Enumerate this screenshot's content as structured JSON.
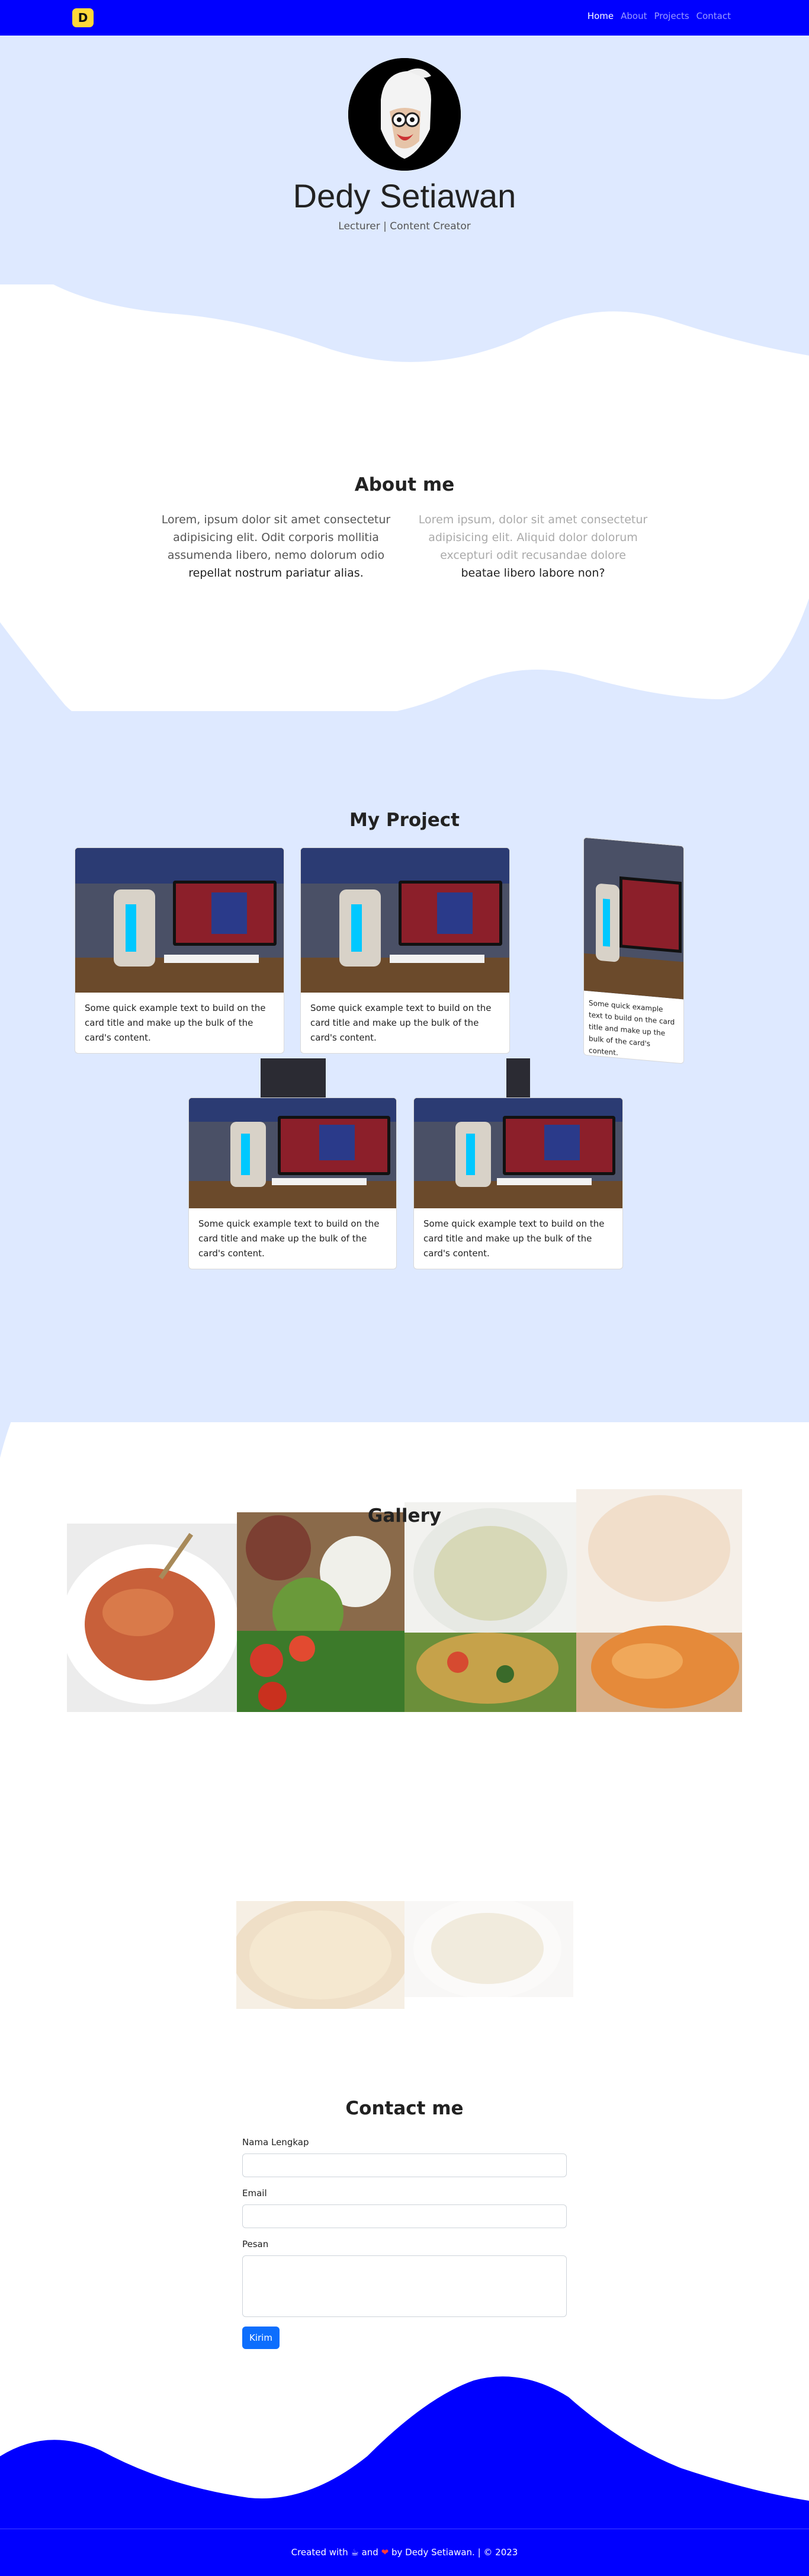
{
  "navbar": {
    "brand_letter": "D",
    "links": [
      {
        "label": "Home",
        "active": true
      },
      {
        "label": "About",
        "active": false
      },
      {
        "label": "Projects",
        "active": false
      },
      {
        "label": "Contact",
        "active": false
      }
    ]
  },
  "hero": {
    "name": "Dedy Setiawan",
    "subtitle": "Lecturer | Content Creator"
  },
  "about": {
    "title": "About me",
    "left_text": "Lorem, ipsum dolor sit amet consectetur adipisicing elit. Odit corporis mollitia assumenda libero, nemo dolorum odio",
    "left_strong": "repellat nostrum pariatur alias.",
    "right_text": "Lorem ipsum, dolor sit amet consectetur adipisicing elit. Aliquid dolor dolorum excepturi odit recusandae dolore",
    "right_strong": "beatae libero labore non?"
  },
  "projects": {
    "title": "My Project",
    "card_text": "Some quick example text to build on the card title and make up the bulk of the card's content."
  },
  "gallery": {
    "title": "Gallery"
  },
  "contact": {
    "title": "Contact me",
    "name_label": "Nama Lengkap",
    "email_label": "Email",
    "message_label": "Pesan",
    "submit_label": "Kirim"
  },
  "footer": {
    "text_created": "Created with",
    "text_and": "and",
    "text_by": "by Dedy Setiawan. | © 2023"
  },
  "colors": {
    "nav_blue": "#0000ff",
    "light_blue": "#dee9ff",
    "brand_yellow": "#ffd83a",
    "button_blue": "#0d6efd"
  }
}
